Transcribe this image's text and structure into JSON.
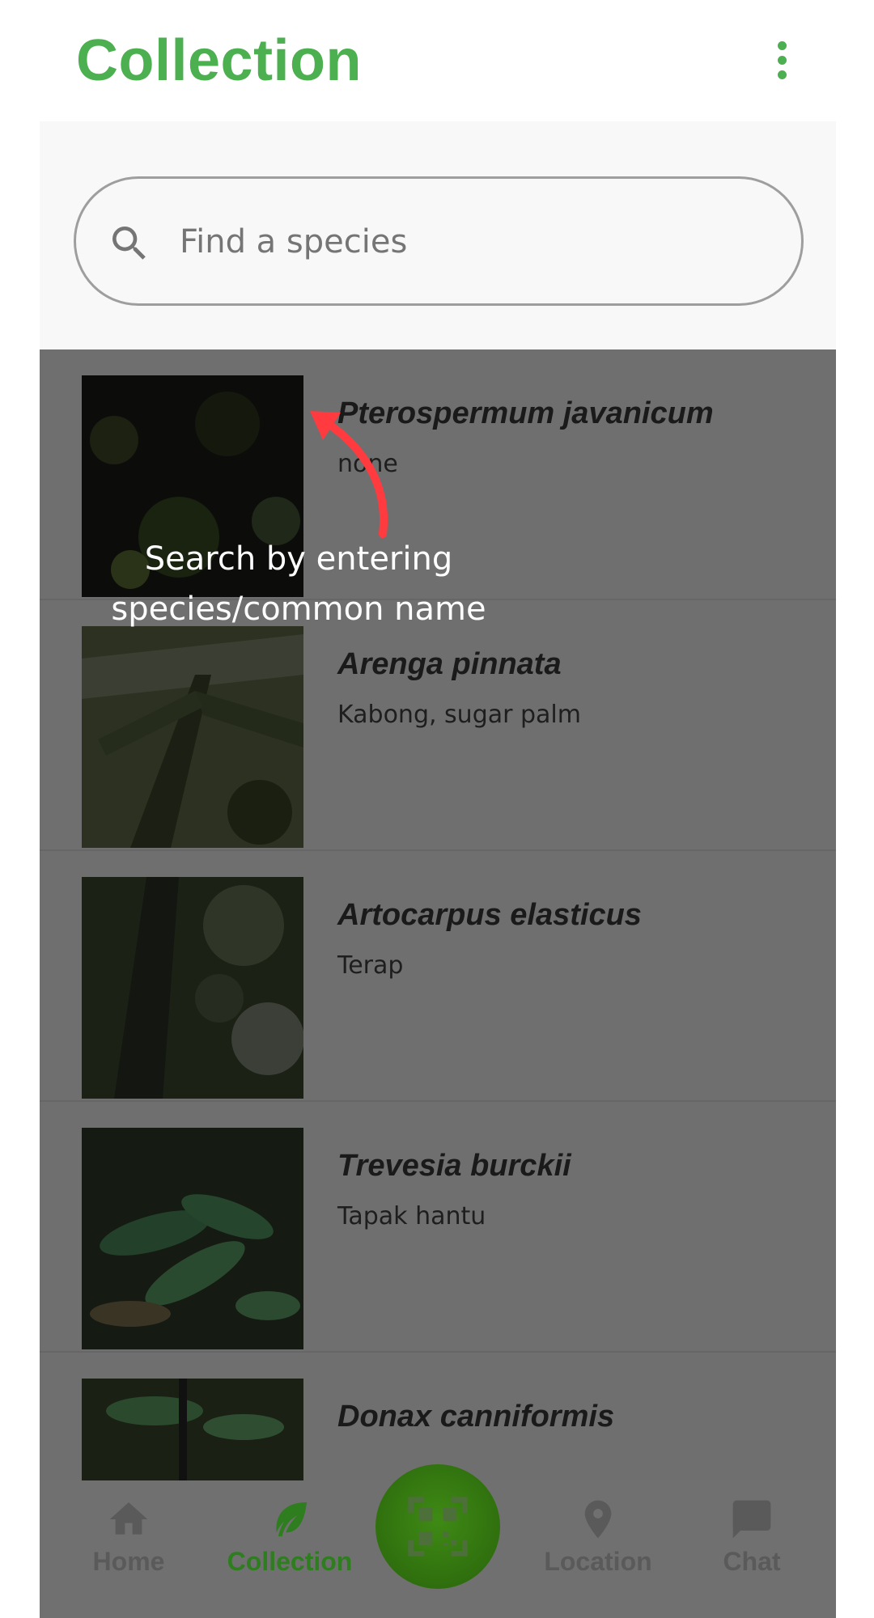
{
  "header": {
    "title": "Collection"
  },
  "search": {
    "placeholder": "Find a species"
  },
  "tooltip": {
    "text": "Search by entering species/common name"
  },
  "species": [
    {
      "scientific": "Pterospermum javanicum",
      "common": "none"
    },
    {
      "scientific": "Arenga pinnata",
      "common": "Kabong, sugar palm"
    },
    {
      "scientific": "Artocarpus elasticus",
      "common": "Terap"
    },
    {
      "scientific": "Trevesia burckii",
      "common": "Tapak hantu"
    },
    {
      "scientific": "Donax canniformis",
      "common": ""
    }
  ],
  "nav": {
    "home": "Home",
    "collection": "Collection",
    "location": "Location",
    "chat": "Chat"
  },
  "colors": {
    "accent": "#4caf50",
    "overlay": "#6f6f6f",
    "active_nav": "#2e7d1f"
  },
  "icons": {
    "menu": "more-vert-icon",
    "search": "search-icon",
    "home": "home-icon",
    "collection": "leaf-icon",
    "scan": "qr-code-icon",
    "location": "location-pin-icon",
    "chat": "chat-bubble-icon"
  }
}
